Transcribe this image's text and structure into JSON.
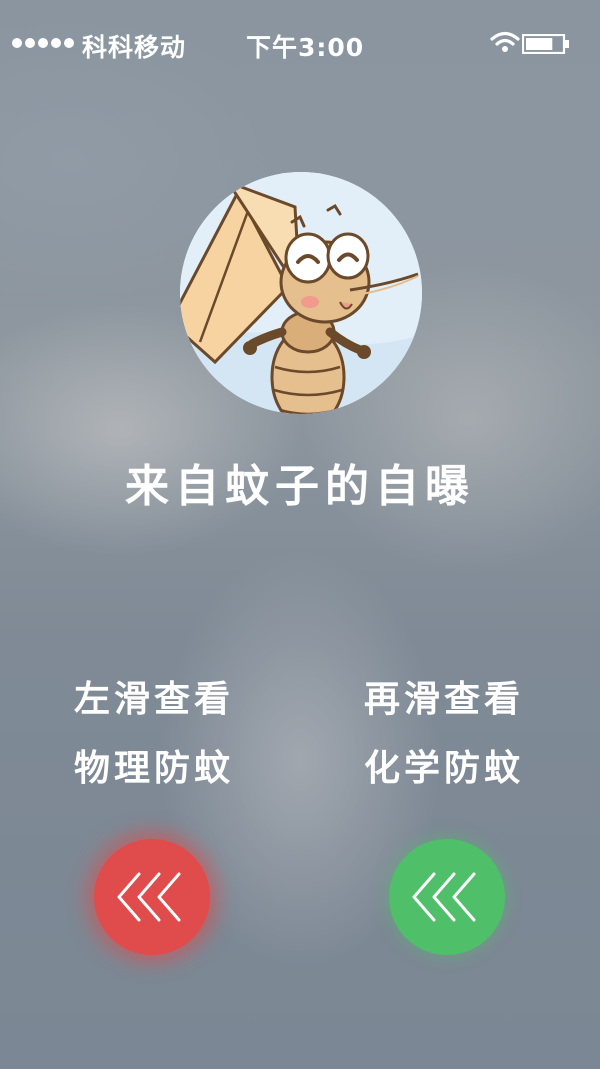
{
  "status_bar": {
    "carrier": "科科移动",
    "time": "下午3:00",
    "signal_dots": 5,
    "battery_level": 0.75
  },
  "call": {
    "caller_name": "来自蚊子的自曝",
    "avatar": "cartoon-mosquito-avatar"
  },
  "hints": {
    "left_line1": "左滑查看",
    "left_line2": "物理防蚊",
    "right_line1": "再滑查看",
    "right_line2": "化学防蚊"
  },
  "buttons": {
    "left": {
      "icon": "triple-chevron-left-icon",
      "color": "#e04b4b"
    },
    "right": {
      "icon": "triple-chevron-left-icon",
      "color": "#4fbf6a"
    }
  }
}
